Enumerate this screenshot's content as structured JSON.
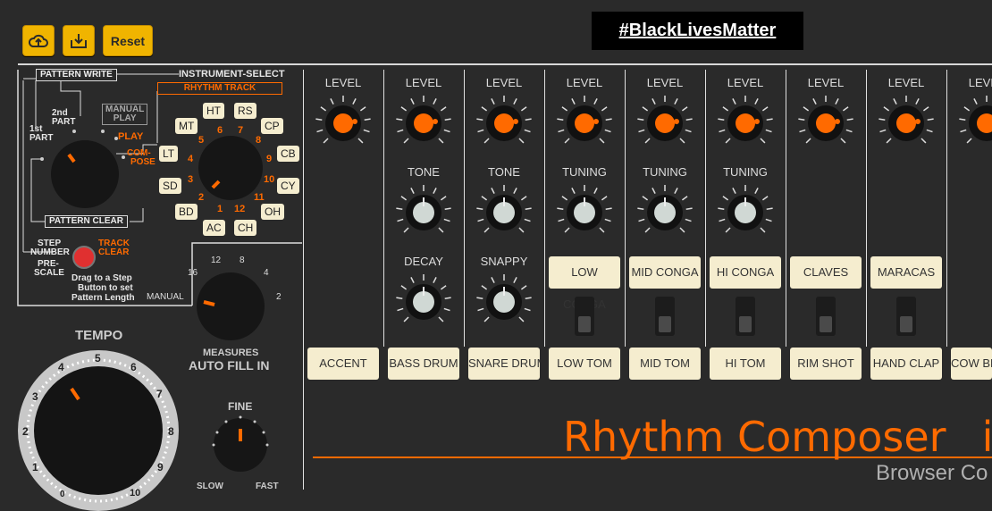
{
  "toolbar": {
    "upload_icon": "cloud-upload-icon",
    "download_icon": "download-icon",
    "reset_label": "Reset"
  },
  "banner": {
    "text": "#BlackLivesMatter"
  },
  "left": {
    "pattern_write": "PATTERN WRITE",
    "instrument_select": "INSTRUMENT-SELECT",
    "rhythm_track": "RHYTHM TRACK",
    "first_part_1": "1st",
    "first_part_2": "PART",
    "second_part_1": "2nd",
    "second_part_2": "PART",
    "manual_play_1": "MANUAL",
    "manual_play_2": "PLAY",
    "play": "PLAY",
    "compose_1": "COM-",
    "compose_2": "POSE",
    "pattern_clear": "PATTERN CLEAR",
    "step_number_1": "STEP",
    "step_number_2": "NUMBER",
    "prescale_1": "PRE-",
    "prescale_2": "SCALE",
    "track_clear_1": "TRACK",
    "track_clear_2": "CLEAR",
    "drag_hint_1": "Drag to a Step",
    "drag_hint_2": "Button to set",
    "drag_hint_3": "Pattern Length",
    "instruments": [
      "HT",
      "RS",
      "MT",
      "CP",
      "LT",
      "CB",
      "SD",
      "CY",
      "BD",
      "OH",
      "AC",
      "CH"
    ],
    "numbers": [
      "1",
      "2",
      "3",
      "4",
      "5",
      "6",
      "7",
      "8",
      "9",
      "10",
      "11",
      "12"
    ],
    "measures_label": "MEASURES",
    "auto_fill_in": "AUTO FILL IN",
    "measures_marks": [
      "16",
      "12",
      "8",
      "4",
      "2"
    ],
    "manual": "MANUAL",
    "tempo": "TEMPO",
    "tempo_marks": [
      "0",
      "1",
      "2",
      "3",
      "4",
      "5",
      "6",
      "7",
      "8",
      "9",
      "10"
    ],
    "fine": "FINE",
    "slow": "SLOW",
    "fast": "FAST"
  },
  "channels": [
    {
      "top": "LEVEL",
      "mid": "",
      "low": "",
      "pad": "ACCENT",
      "top_pad": ""
    },
    {
      "top": "LEVEL",
      "mid": "TONE",
      "low": "DECAY",
      "pad": "BASS DRUM",
      "top_pad": ""
    },
    {
      "top": "LEVEL",
      "mid": "TONE",
      "low": "SNAPPY",
      "pad": "SNARE DRUM",
      "top_pad": ""
    },
    {
      "top": "LEVEL",
      "mid": "TUNING",
      "low": "",
      "pad": "LOW TOM",
      "top_pad": "LOW CONGA"
    },
    {
      "top": "LEVEL",
      "mid": "TUNING",
      "low": "",
      "pad": "MID TOM",
      "top_pad": "MID CONGA"
    },
    {
      "top": "LEVEL",
      "mid": "TUNING",
      "low": "",
      "pad": "HI TOM",
      "top_pad": "HI CONGA"
    },
    {
      "top": "LEVEL",
      "mid": "",
      "low": "",
      "pad": "RIM SHOT",
      "top_pad": "CLAVES"
    },
    {
      "top": "LEVEL",
      "mid": "",
      "low": "",
      "pad": "HAND CLAP",
      "top_pad": "MARACAS"
    },
    {
      "top": "LEVEL",
      "mid": "",
      "low": "",
      "pad": "COW BELL",
      "top_pad": ""
    }
  ],
  "brand": {
    "title": "Rhythm Composer",
    "suffix": "iO",
    "subtitle": "Browser Co"
  },
  "colors": {
    "accent": "#ff6a00",
    "panel": "#2a2a2a",
    "pad": "#f5edcf",
    "button": "#f0b400"
  }
}
